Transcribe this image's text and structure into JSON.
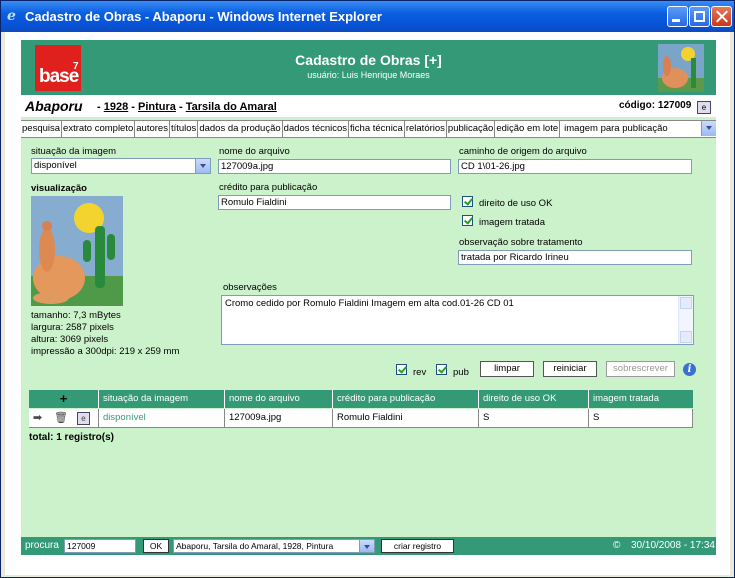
{
  "window": {
    "title": "Cadastro de Obras - Abaporu - Windows Internet Explorer"
  },
  "header": {
    "logo_text": "base",
    "logo_sup": "7",
    "title": "Cadastro de Obras [+]",
    "user": "usuário: Luis Henrique Moraes"
  },
  "work": {
    "title": "Abaporu",
    "year": "1928",
    "type": "Pintura",
    "artist": "Tarsila do Amaral",
    "code": "código: 127009"
  },
  "tabs": [
    "pesquisa",
    "extrato completo",
    "autores",
    "títulos",
    "dados da produção",
    "dados técnicos",
    "ficha técnica",
    "relatórios",
    "publicação",
    "edição em lote",
    "imagem para publicação"
  ],
  "form": {
    "situacao_label": "situação da imagem",
    "situacao_value": "disponível",
    "nome_label": "nome do arquivo",
    "nome_value": "127009a.jpg",
    "caminho_label": "caminho de origem do arquivo",
    "caminho_value": "CD 1\\01-26.jpg",
    "visualizacao_label": "visualização",
    "credito_label": "crédito para publicação",
    "credito_value": "Romulo Fialdini",
    "direito_label": "direito de uso OK",
    "tratada_label": "imagem tratada",
    "obs_tratamento_label": "observação sobre tratamento",
    "obs_tratamento_value": "tratada por Ricardo Irineu",
    "observacoes_label": "observações",
    "observacoes_value": "Cromo cedido por Romulo Fialdini  Imagem em alta cod.01-26 CD 01",
    "tamanho": "tamanho: 7,3 mBytes",
    "largura": "largura: 2587 pixels",
    "altura": "altura: 3069 pixels",
    "impressao": "impressão a 300dpi: 219 x 259 mm",
    "rev_label": "rev",
    "pub_label": "pub",
    "btn_limpar": "limpar",
    "btn_reiniciar": "reiniciar",
    "btn_sobrescrever": "sobrescrever"
  },
  "table": {
    "add": "+",
    "headers": [
      "situação da imagem",
      "nome do arquivo",
      "crédito para publicação",
      "direito de uso OK",
      "imagem tratada"
    ],
    "row": [
      "disponível",
      "127009a.jpg",
      "Romulo Fialdini",
      "S",
      "S"
    ],
    "total": "total: 1 registro(s)"
  },
  "footer": {
    "procura_label": "procura",
    "procura_value": "127009",
    "ok": "OK",
    "select_value": "Abaporu, Tarsila do Amaral, 1928, Pintura",
    "criar": "criar registro",
    "copyright": "©",
    "datetime": "30/10/2008 - 17:34"
  },
  "colors": {
    "accent": "#339977",
    "background": "#ccf2cc",
    "link": "#339977"
  }
}
